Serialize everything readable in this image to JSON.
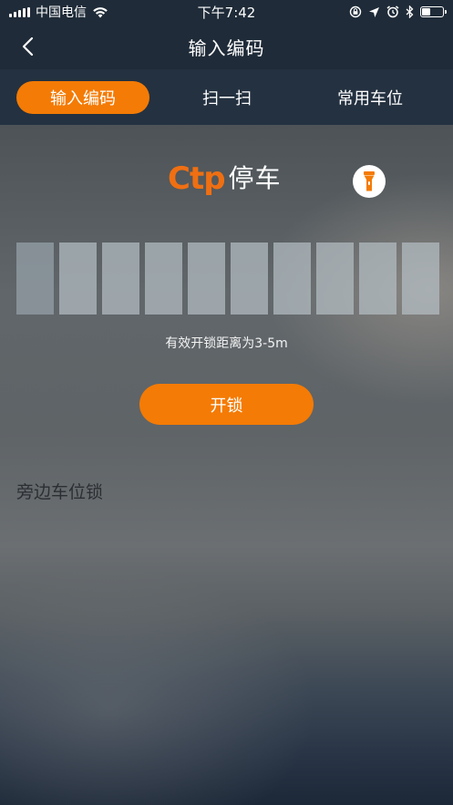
{
  "status_bar": {
    "carrier": "中国电信",
    "time": "下午7:42"
  },
  "nav": {
    "title": "输入编码"
  },
  "tabs": [
    {
      "label": "输入编码",
      "active": true
    },
    {
      "label": "扫一扫",
      "active": false
    },
    {
      "label": "常用车位",
      "active": false
    }
  ],
  "logo": {
    "mark": "Ctp",
    "text": "停车"
  },
  "code_input": {
    "length": 10,
    "values": [
      "",
      "",
      "",
      "",
      "",
      "",
      "",
      "",
      "",
      ""
    ]
  },
  "hint": "有效开锁距离为3-5m",
  "unlock_button": "开锁",
  "nearby_label": "旁边车位锁",
  "colors": {
    "accent": "#f47b05",
    "header_bg": "#1f2b38",
    "tab_bar_bg": "#243140"
  },
  "icons": [
    "signal-icon",
    "wifi-icon",
    "lock-rotation-icon",
    "location-icon",
    "alarm-icon",
    "bluetooth-icon",
    "battery-icon",
    "back-icon",
    "flashlight-icon"
  ]
}
